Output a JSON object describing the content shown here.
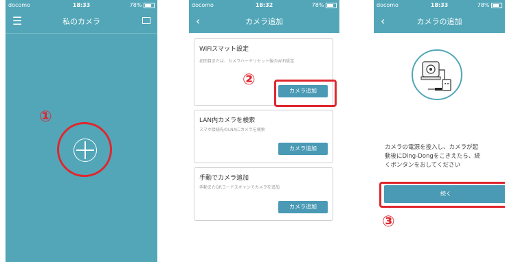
{
  "status": {
    "carrier": "docomo",
    "time1": "18:33",
    "time2": "18:32",
    "time3": "18:33",
    "battery": "78%"
  },
  "screen1": {
    "title": "私のカメラ",
    "step": "①"
  },
  "screen2": {
    "title": "カメラ追加",
    "step": "②",
    "cards": [
      {
        "title": "WiFiスマット設定",
        "desc": "初回目または、カメラハードリセット後のWiFi設定",
        "button": "カメラ追加"
      },
      {
        "title": "LAN内カメラを検索",
        "desc": "スマホ接続先のLNAにカメラを検索",
        "button": "カメラ追加"
      },
      {
        "title": "手動でカメラ追加",
        "desc": "手動またQRコードスキャンでカメラを追加",
        "button": "カメラ追加"
      }
    ]
  },
  "screen3": {
    "title": "カメラの追加",
    "step": "③",
    "message_lines": [
      "カメラの電源を投入し、カメラが起",
      "動後にDing-Dongをこきえたら、続",
      "くボンタンをおしてください"
    ],
    "continue": "続く"
  },
  "colors": {
    "teal": "#52a6b8",
    "button": "#4a9ab5",
    "highlight": "#e0262e"
  },
  "icons": {
    "menu": "hamburger-icon",
    "grid": "grid-icon",
    "back": "back-chevron-icon",
    "add": "plus-circle-icon"
  }
}
